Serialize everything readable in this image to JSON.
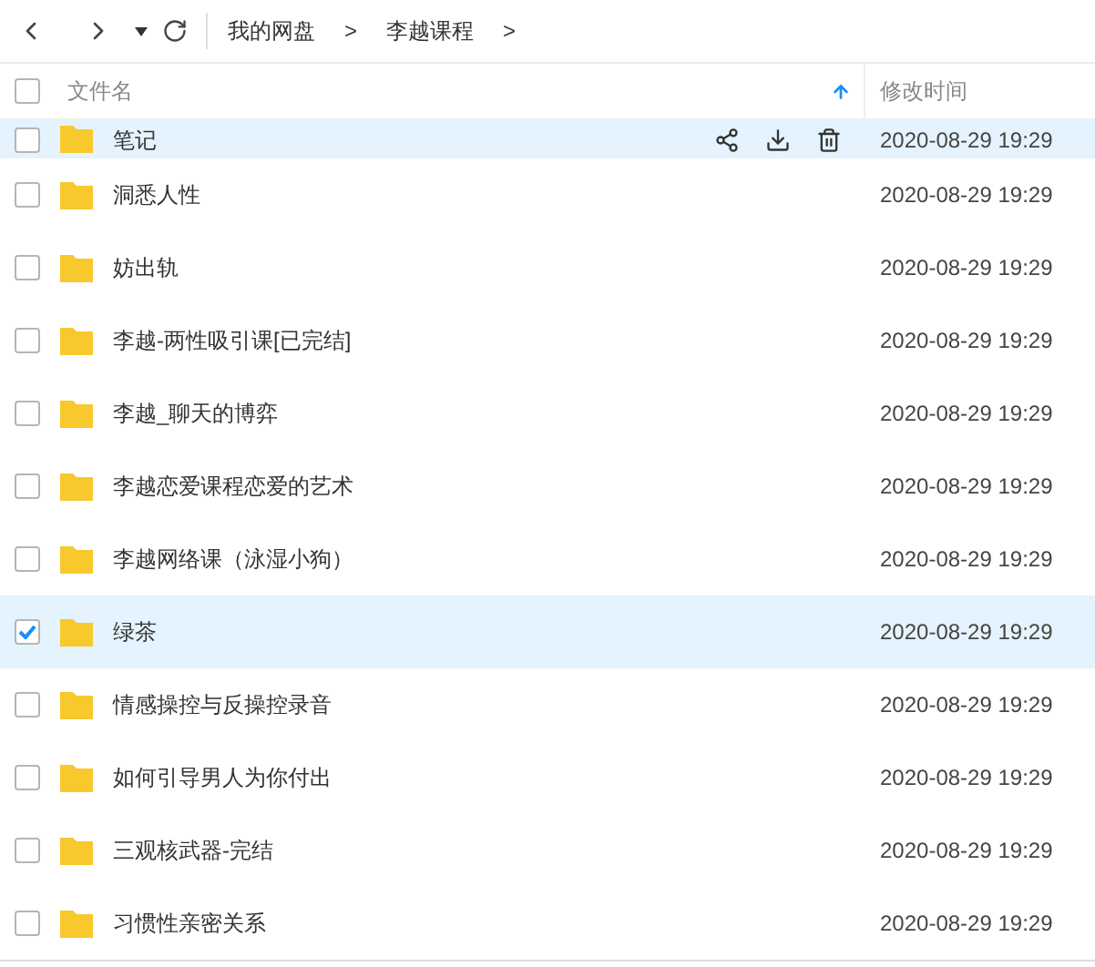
{
  "breadcrumb": [
    "我的网盘",
    "李越课程"
  ],
  "breadcrumb_separator": ">",
  "columns": {
    "name": "文件名",
    "modified": "修改时间",
    "select_all_checked": false
  },
  "rows": [
    {
      "name": "笔记",
      "modified": "2020-08-29 19:29",
      "checked": false,
      "hovered": true
    },
    {
      "name": "洞悉人性",
      "modified": "2020-08-29 19:29",
      "checked": false,
      "hovered": false
    },
    {
      "name": "妨出轨",
      "modified": "2020-08-29 19:29",
      "checked": false,
      "hovered": false
    },
    {
      "name": "李越-两性吸引课[已完结]",
      "modified": "2020-08-29 19:29",
      "checked": false,
      "hovered": false
    },
    {
      "name": "李越_聊天的博弈",
      "modified": "2020-08-29 19:29",
      "checked": false,
      "hovered": false
    },
    {
      "name": "李越恋爱课程恋爱的艺术",
      "modified": "2020-08-29 19:29",
      "checked": false,
      "hovered": false
    },
    {
      "name": "李越网络课（泳湿小狗）",
      "modified": "2020-08-29 19:29",
      "checked": false,
      "hovered": false
    },
    {
      "name": "绿茶",
      "modified": "2020-08-29 19:29",
      "checked": true,
      "hovered": false
    },
    {
      "name": "情感操控与反操控录音",
      "modified": "2020-08-29 19:29",
      "checked": false,
      "hovered": false
    },
    {
      "name": "如何引导男人为你付出",
      "modified": "2020-08-29 19:29",
      "checked": false,
      "hovered": false
    },
    {
      "name": "三观核武器-完结",
      "modified": "2020-08-29 19:29",
      "checked": false,
      "hovered": false
    },
    {
      "name": "习惯性亲密关系",
      "modified": "2020-08-29 19:29",
      "checked": false,
      "hovered": false
    }
  ]
}
